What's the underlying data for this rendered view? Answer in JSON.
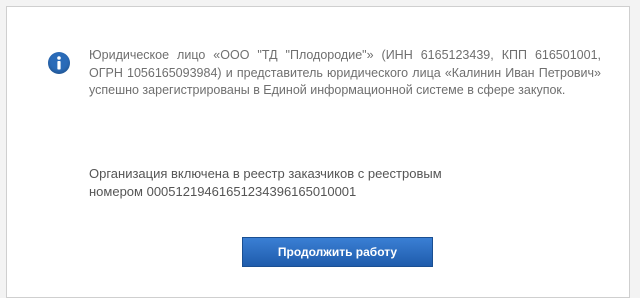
{
  "notice": {
    "icon": "info-icon",
    "message": "Юридическое лицо «ООО \"ТД \"Плодородие\"» (ИНН 6165123439, КПП 616501001, ОГРН 1056165093984) и представитель юридического лица «Калинин Иван Петрович» успешно зарегистрированы в Единой информационной системе в сфере закупок.",
    "registry_line1": "Организация включена в реестр заказчиков с реестровым",
    "registry_line2": "номером 00051219461651234396165010001"
  },
  "actions": {
    "continue_label": "Продолжить работу"
  },
  "colors": {
    "icon_blue": "#2a6bb8",
    "button_blue": "#2a6bc0",
    "text_gray": "#6f6f6f"
  }
}
